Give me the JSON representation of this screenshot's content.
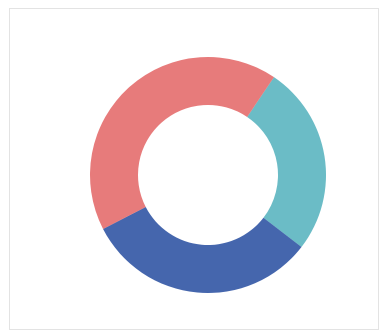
{
  "chart_data": {
    "type": "pie",
    "donut": true,
    "title": "",
    "legend": "none",
    "slices": [
      {
        "value": 26,
        "color": "#6bbcc6"
      },
      {
        "value": 32,
        "color": "#4566ad"
      },
      {
        "value": 42,
        "color": "#e77b7b"
      }
    ]
  }
}
